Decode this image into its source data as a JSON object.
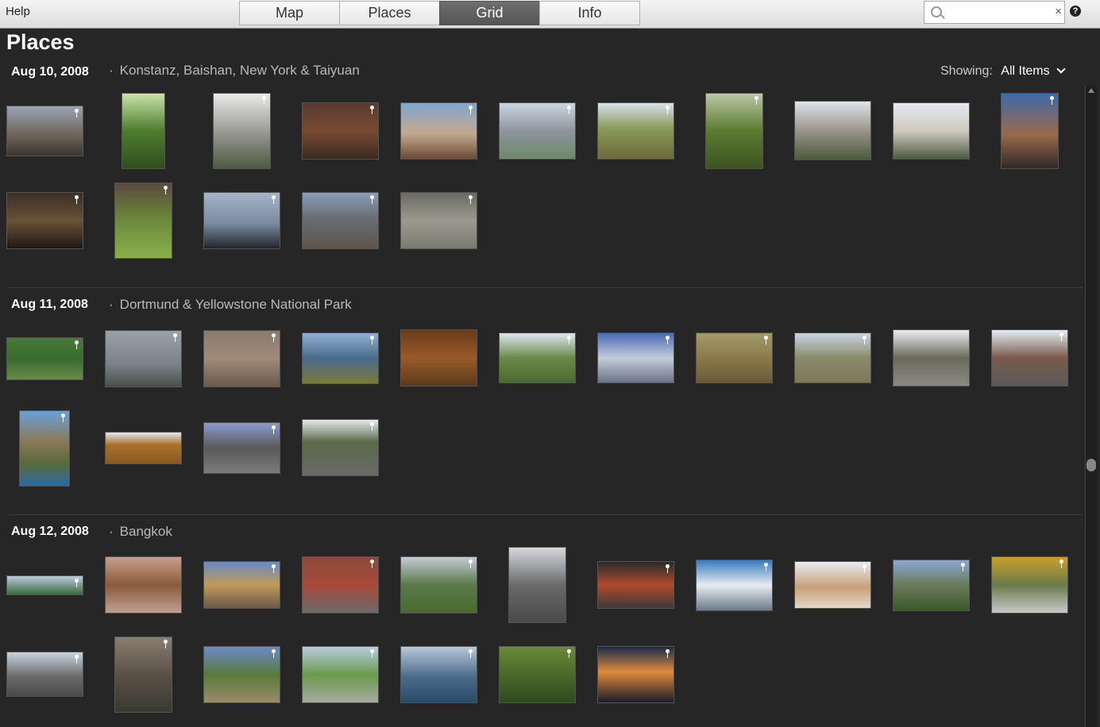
{
  "topbar": {
    "help_label": "Help",
    "tabs": [
      {
        "label": "Map"
      },
      {
        "label": "Places"
      },
      {
        "label": "Grid"
      },
      {
        "label": "Info"
      }
    ],
    "search": {
      "value": "",
      "placeholder": ""
    }
  },
  "page": {
    "title": "Places",
    "showing_label": "Showing:",
    "showing_value": "All Items"
  },
  "sections": [
    {
      "date": "Aug 10, 2008",
      "places": "Konstanz, Baishan, New York & Taiyuan"
    },
    {
      "date": "Aug 11, 2008",
      "places": "Dortmund & Yellowstone National Park"
    },
    {
      "date": "Aug 12, 2008",
      "places": "Bangkok"
    }
  ],
  "colors": {
    "accent_tab": "#5f5f5f",
    "background": "#262626"
  }
}
